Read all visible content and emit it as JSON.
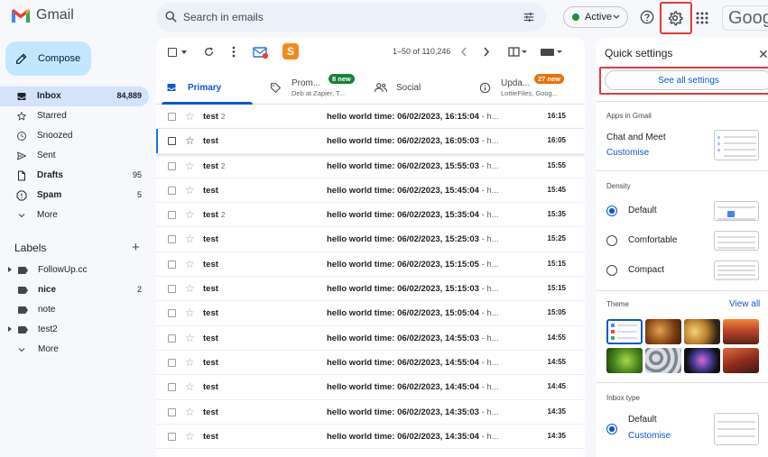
{
  "app": {
    "name": "Gmail"
  },
  "search": {
    "placeholder": "Search in emails"
  },
  "status": {
    "label": "Active"
  },
  "brand_partial": "Googl",
  "compose": {
    "label": "Compose"
  },
  "nav": [
    {
      "label": "Inbox",
      "count": "84,889",
      "icon": "inbox-icon",
      "selected": true
    },
    {
      "label": "Starred",
      "count": "",
      "icon": "star-icon"
    },
    {
      "label": "Snoozed",
      "count": "",
      "icon": "clock-icon"
    },
    {
      "label": "Sent",
      "count": "",
      "icon": "send-icon"
    },
    {
      "label": "Drafts",
      "count": "95",
      "icon": "draft-icon",
      "bold": true
    },
    {
      "label": "Spam",
      "count": "5",
      "icon": "spam-icon",
      "bold": true
    },
    {
      "label": "More",
      "count": "",
      "icon": "chevron-down-icon"
    }
  ],
  "labels": {
    "heading": "Labels",
    "items": [
      {
        "label": "FollowUp.cc",
        "count": "",
        "expandable": true
      },
      {
        "label": "nice",
        "count": "2",
        "bold": true
      },
      {
        "label": "note",
        "count": ""
      },
      {
        "label": "test2",
        "count": "",
        "expandable": true
      },
      {
        "label": "More",
        "count": ""
      }
    ]
  },
  "toolbar": {
    "range": "1–50 of 110,246"
  },
  "tabs": [
    {
      "label": "Primary",
      "icon": "inbox-tab-icon"
    },
    {
      "label": "Prom...",
      "badge": "8 new",
      "subtitle": "Deb at Zapier, T...",
      "badge_color": "#188038",
      "icon": "tag-icon"
    },
    {
      "label": "Social",
      "icon": "people-icon"
    },
    {
      "label": "Upda...",
      "badge": "27 new",
      "subtitle": "LottieFiles, Goog...",
      "badge_color": "#e8710a",
      "icon": "info-icon"
    }
  ],
  "emails": [
    {
      "sender": "test",
      "count": "2",
      "subject": "hello world time: 06/02/2023, 16:15:04",
      "snippet": " - h...",
      "time": "16:15"
    },
    {
      "sender": "test",
      "count": "",
      "subject": "hello world time: 06/02/2023, 16:05:03",
      "snippet": " - h...",
      "time": "16:05",
      "highlight": true
    },
    {
      "sender": "test",
      "count": "2",
      "subject": "hello world time: 06/02/2023, 15:55:03",
      "snippet": " - h...",
      "time": "15:55"
    },
    {
      "sender": "test",
      "count": "",
      "subject": "hello world time: 06/02/2023, 15:45:04",
      "snippet": " - h...",
      "time": "15:45"
    },
    {
      "sender": "test",
      "count": "2",
      "subject": "hello world time: 06/02/2023, 15:35:04",
      "snippet": " - h...",
      "time": "15:35"
    },
    {
      "sender": "test",
      "count": "",
      "subject": "hello world time: 06/02/2023, 15:25:03",
      "snippet": " - h...",
      "time": "15:25"
    },
    {
      "sender": "test",
      "count": "",
      "subject": "hello world time: 06/02/2023, 15:15:05",
      "snippet": " - h...",
      "time": "15:15"
    },
    {
      "sender": "test",
      "count": "",
      "subject": "hello world time: 06/02/2023, 15:15:03",
      "snippet": " - h...",
      "time": "15:15"
    },
    {
      "sender": "test",
      "count": "",
      "subject": "hello world time: 06/02/2023, 15:05:04",
      "snippet": " - h...",
      "time": "15:05"
    },
    {
      "sender": "test",
      "count": "",
      "subject": "hello world time: 06/02/2023, 14:55:03",
      "snippet": " - h...",
      "time": "14:55"
    },
    {
      "sender": "test",
      "count": "",
      "subject": "hello world time: 06/02/2023, 14:55:04",
      "snippet": " - h...",
      "time": "14:55"
    },
    {
      "sender": "test",
      "count": "",
      "subject": "hello world time: 06/02/2023, 14:45:04",
      "snippet": " - h...",
      "time": "14:45"
    },
    {
      "sender": "test",
      "count": "",
      "subject": "hello world time: 06/02/2023, 14:35:03",
      "snippet": " - h...",
      "time": "14:35"
    },
    {
      "sender": "test",
      "count": "",
      "subject": "hello world time: 06/02/2023, 14:35:04",
      "snippet": " - h...",
      "time": "14:35"
    }
  ],
  "quick_settings": {
    "title": "Quick settings",
    "see_all": "See all settings",
    "apps_heading": "Apps in Gmail",
    "chat_meet": "Chat and Meet",
    "customise": "Customise",
    "density_heading": "Density",
    "density_options": [
      {
        "label": "Default",
        "selected": true
      },
      {
        "label": "Comfortable",
        "selected": false
      },
      {
        "label": "Compact",
        "selected": false
      }
    ],
    "theme_heading": "Theme",
    "view_all": "View all",
    "inbox_type_heading": "Inbox type",
    "inbox_default": "Default",
    "inbox_customise": "Customise"
  },
  "colors": {
    "accent": "#0b57d0",
    "selected_nav": "#d3e3fd",
    "compose": "#c2e7ff",
    "highlight_box": "#e53935"
  }
}
